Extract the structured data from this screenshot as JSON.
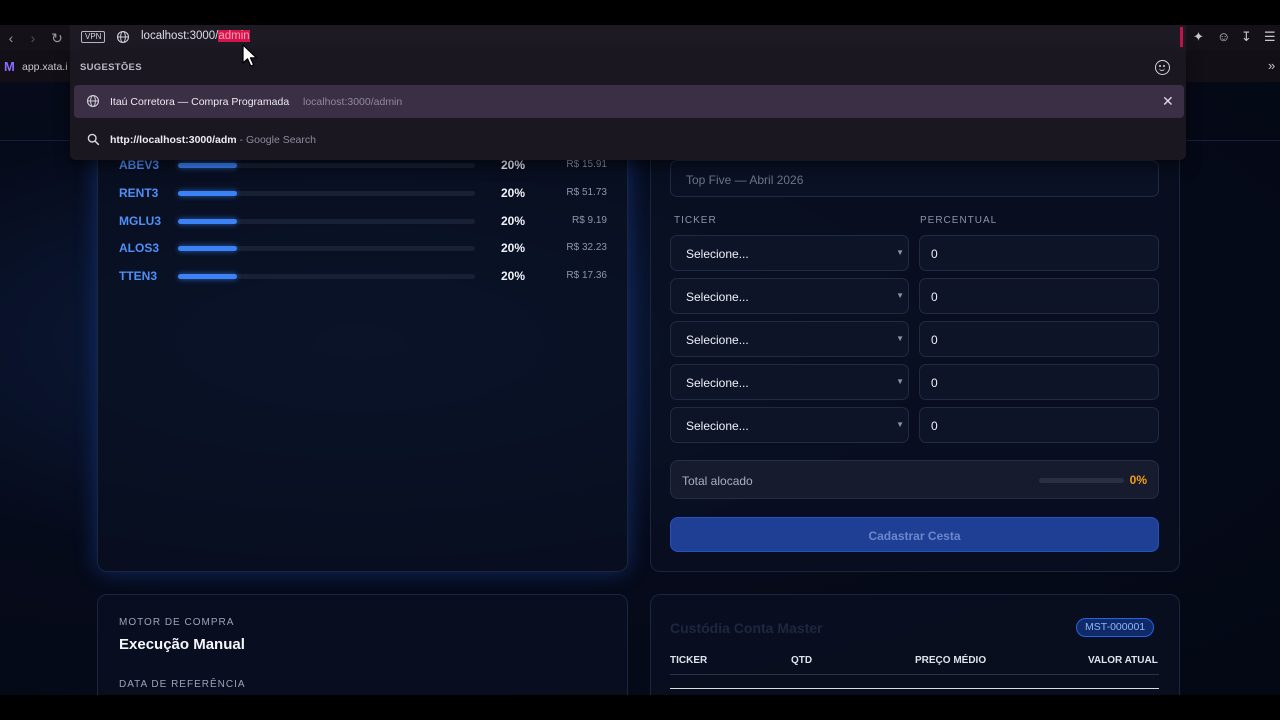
{
  "browser": {
    "vpn_label": "VPN",
    "url_base": "localhost:3000/",
    "url_selected": "admin",
    "bookmark_label": "app.xata.i",
    "suggestions": {
      "title": "SUGESTÕES",
      "history_title": "Itaú Corretora — Compra Programada",
      "history_url": "localhost:3000/admin",
      "search_query": "http://localhost:3000/adm",
      "search_suffix": " - Google Search"
    }
  },
  "allocation": {
    "rows": [
      {
        "ticker": "ABEV3",
        "pct": "20%",
        "price": "R$ 15.91",
        "fill": 0.2
      },
      {
        "ticker": "RENT3",
        "pct": "20%",
        "price": "R$ 51.73",
        "fill": 0.2
      },
      {
        "ticker": "MGLU3",
        "pct": "20%",
        "price": "R$ 9.19",
        "fill": 0.2
      },
      {
        "ticker": "ALOS3",
        "pct": "20%",
        "price": "R$ 32.23",
        "fill": 0.2
      },
      {
        "ticker": "TTEN3",
        "pct": "20%",
        "price": "R$ 17.36",
        "fill": 0.2
      }
    ]
  },
  "form": {
    "name_placeholder": "Top Five — Abril 2026",
    "ticker_label": "TICKER",
    "percent_label": "PERCENTUAL",
    "rows": [
      {
        "select": "Selecione...",
        "value": "0"
      },
      {
        "select": "Selecione...",
        "value": "0"
      },
      {
        "select": "Selecione...",
        "value": "0"
      },
      {
        "select": "Selecione...",
        "value": "0"
      },
      {
        "select": "Selecione...",
        "value": "0"
      }
    ],
    "total_label": "Total alocado",
    "total_pct": "0%",
    "total_fill": 0,
    "submit_label": "Cadastrar Cesta"
  },
  "motor": {
    "kicker": "MOTOR DE COMPRA",
    "title": "Execução Manual",
    "date_label": "DATA DE REFERÊNCIA"
  },
  "custodia": {
    "title": "Custódia Conta Master",
    "badge": "MST-000001",
    "headers": [
      "TICKER",
      "QTD",
      "PREÇO MÉDIO",
      "VALOR ATUAL"
    ]
  },
  "colors": {
    "accent": "#3b82f6",
    "warning": "#f59e0b",
    "selection": "#d3154b"
  }
}
